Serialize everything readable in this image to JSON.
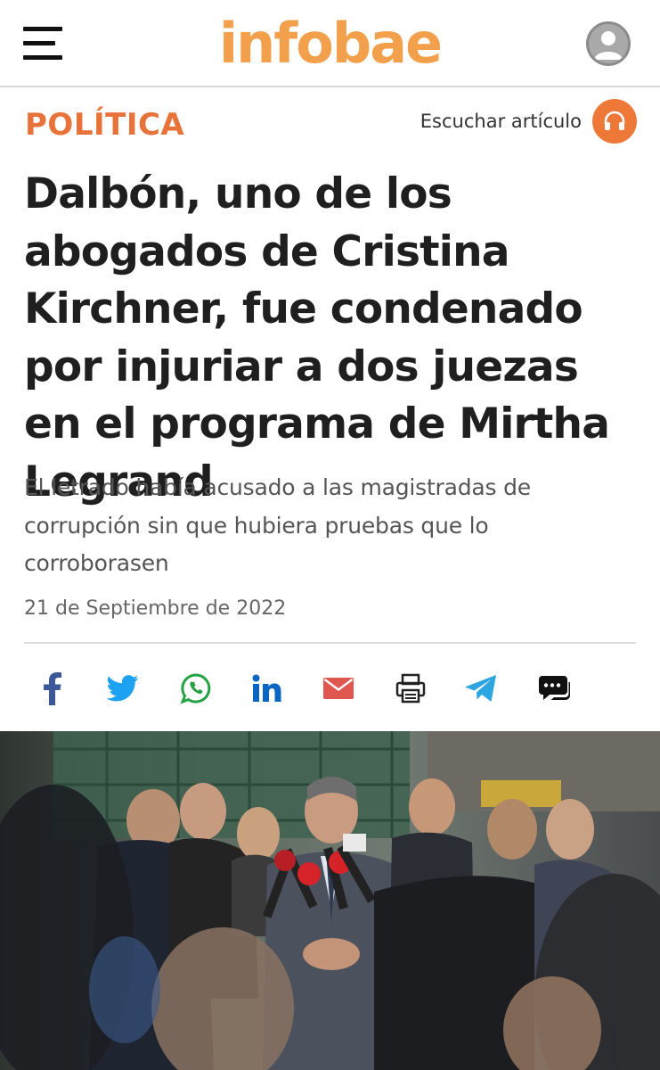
{
  "header": {
    "logo_text": "infobae",
    "menu_icon": "hamburger-menu-icon",
    "user_icon": "user-avatar-icon"
  },
  "article": {
    "section": "POLÍTICA",
    "listen_label": "Escuchar artículo",
    "listen_icon": "headphones-icon",
    "headline": "Dalbón, uno de los abogados de Cristina Kirchner, fue condenado por injuriar a dos juezas en el programa de Mirtha Legrand",
    "subtitle": "El letrado había acusado a las magistradas de corrupción sin que hubiera pruebas que lo corroborasen",
    "date": "21 de Septiembre de 2022"
  },
  "share": {
    "icons": [
      "facebook-icon",
      "twitter-icon",
      "whatsapp-icon",
      "linkedin-icon",
      "email-icon",
      "print-icon",
      "telegram-icon",
      "comments-icon"
    ]
  },
  "colors": {
    "brand": "#f2a04b",
    "section": "#e8733a",
    "facebook": "#3b5998",
    "twitter": "#1da1f2",
    "whatsapp": "#25a244",
    "linkedin": "#0a66c2",
    "email": "#e0574f",
    "telegram": "#2ca5e0"
  }
}
